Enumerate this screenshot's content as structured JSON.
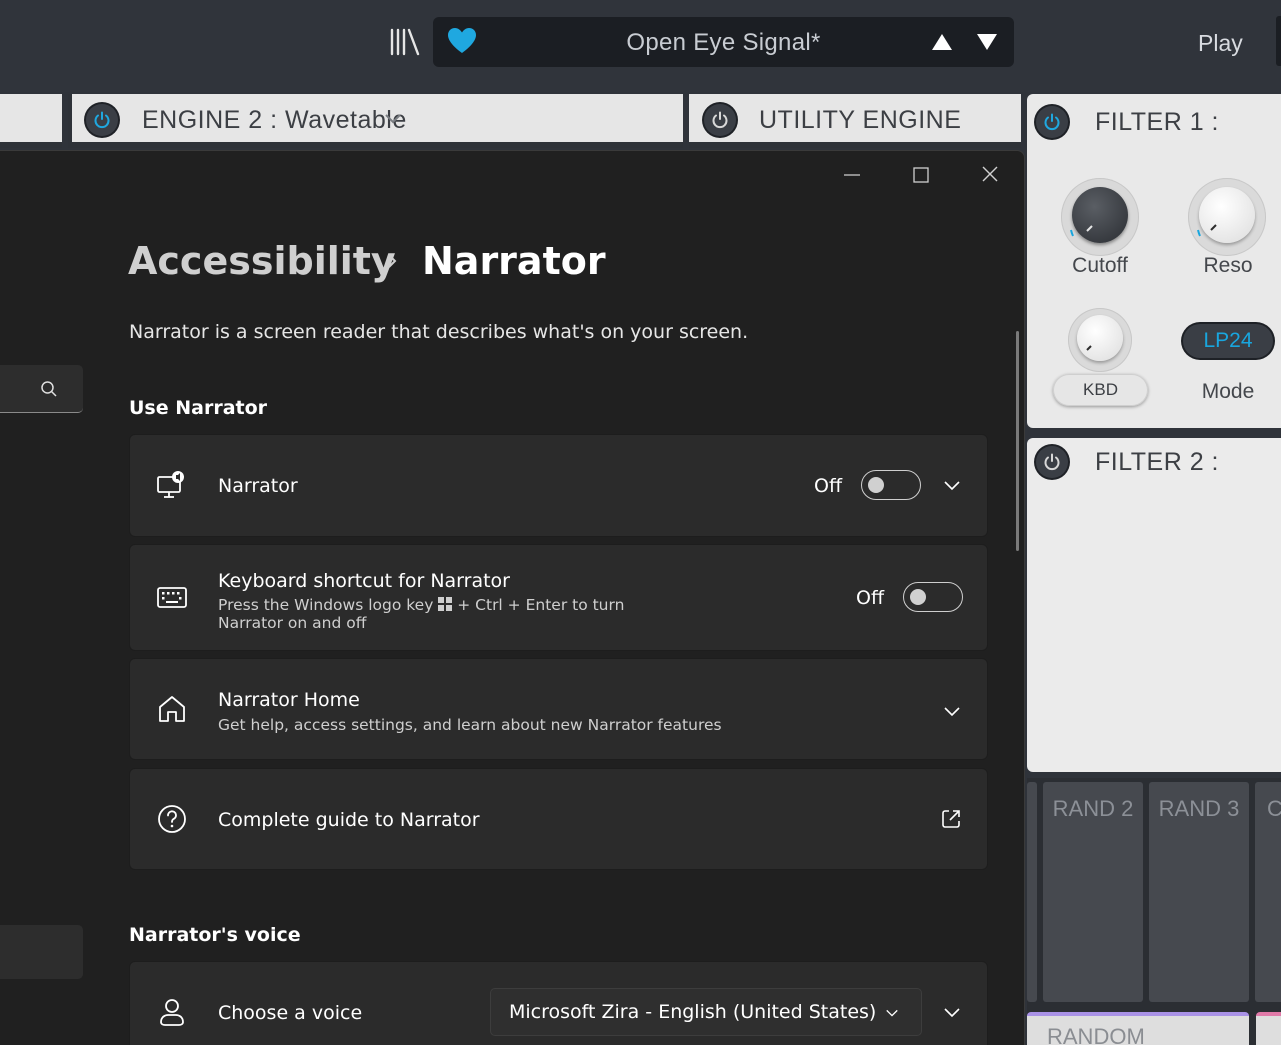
{
  "host_app": {
    "preset_name": "Open Eye Signal*",
    "play_label": "Play",
    "engine2_label": "ENGINE 2 :  Wavetable",
    "utility_engine_label": "UTILITY ENGINE",
    "filter1_label": "FILTER 1 :",
    "filter2_label": "FILTER 2 :",
    "knobs": {
      "cutoff": "Cutoff",
      "reso": "Reso",
      "kbd": "KBD",
      "mode_value": "LP24",
      "mode_label": "Mode"
    },
    "rand_labels": [
      "RAND 2",
      "RAND 3",
      "C"
    ],
    "random_label": "RANDOM",
    "accent_color": "#19a6de"
  },
  "settings": {
    "breadcrumb": {
      "parent": "Accessibility",
      "current": "Narrator"
    },
    "description": "Narrator is a screen reader that describes what's on your screen.",
    "use_narrator": {
      "title": "Use Narrator",
      "narrator": {
        "label": "Narrator",
        "state": "Off",
        "icon": "narrator-icon"
      },
      "shortcut": {
        "label": "Keyboard shortcut for Narrator",
        "desc_line1": "Press the Windows logo key",
        "desc_line1b": "+ Ctrl + Enter to turn",
        "desc_line2": "Narrator on and off",
        "state": "Off",
        "icon": "keyboard-icon"
      },
      "home": {
        "label": "Narrator Home",
        "desc": "Get help, access settings, and learn about new Narrator features",
        "icon": "home-icon"
      },
      "guide": {
        "label": "Complete guide to Narrator",
        "icon": "help-icon"
      }
    },
    "voice": {
      "title": "Narrator's voice",
      "choose": {
        "label": "Choose a voice",
        "value": "Microsoft Zira - English (United States)",
        "icon": "person-icon"
      }
    }
  }
}
